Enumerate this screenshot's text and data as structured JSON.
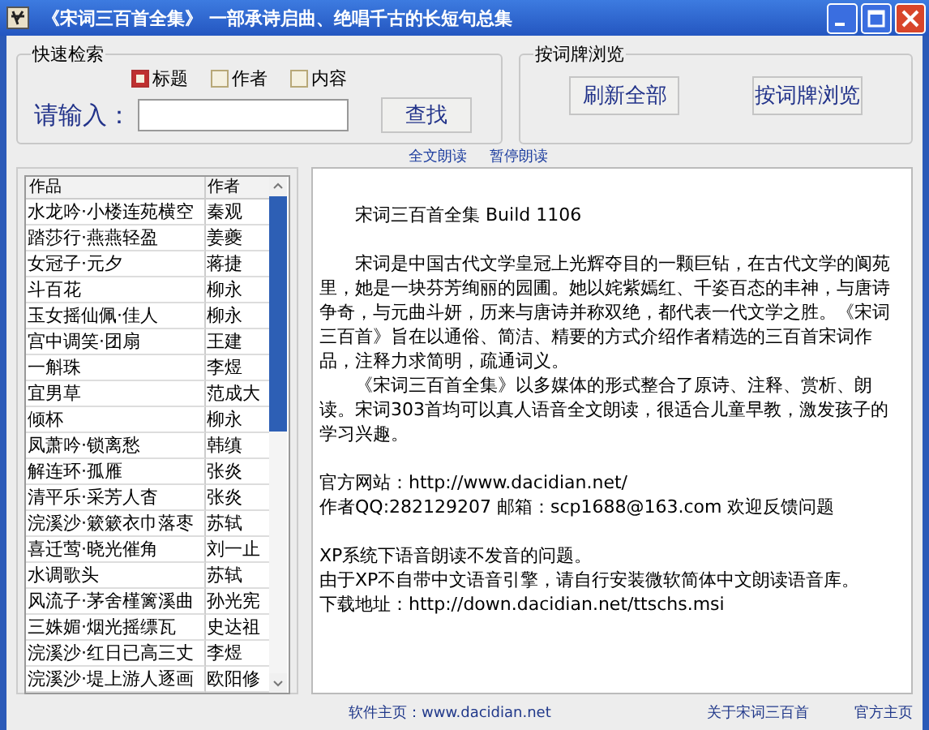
{
  "window": {
    "title": "《宋词三百首全集》  一部承诗启曲、绝唱千古的长短句总集"
  },
  "search": {
    "legend": "快速检索",
    "options": [
      {
        "label": "标题",
        "checked": true
      },
      {
        "label": "作者",
        "checked": false
      },
      {
        "label": "内容",
        "checked": false
      }
    ],
    "input_label": "请输入：",
    "button": "查找"
  },
  "browse": {
    "legend": "按词牌浏览",
    "buttons": [
      "刷新全部",
      "按词牌浏览"
    ]
  },
  "read_links": [
    "全文朗读",
    "暂停朗读"
  ],
  "list": {
    "columns": [
      "作品",
      "作者"
    ],
    "rows": [
      {
        "title": "水龙吟·小楼连苑横空",
        "author": "秦观"
      },
      {
        "title": "踏莎行·燕燕轻盈",
        "author": "姜夔"
      },
      {
        "title": "女冠子·元夕",
        "author": "蒋捷"
      },
      {
        "title": "斗百花",
        "author": "柳永"
      },
      {
        "title": "玉女摇仙佩·佳人",
        "author": "柳永"
      },
      {
        "title": "宫中调笑·团扇",
        "author": "王建"
      },
      {
        "title": "一斛珠",
        "author": "李煜"
      },
      {
        "title": "宜男草",
        "author": "范成大"
      },
      {
        "title": "倾杯",
        "author": "柳永"
      },
      {
        "title": "凤萧吟·锁离愁",
        "author": "韩缜"
      },
      {
        "title": "解连环·孤雁",
        "author": "张炎"
      },
      {
        "title": "清平乐·采芳人杳",
        "author": "张炎"
      },
      {
        "title": "浣溪沙·簌簌衣巾落枣",
        "author": "苏轼"
      },
      {
        "title": "喜迁莺·晓光催角",
        "author": "刘一止"
      },
      {
        "title": "水调歌头",
        "author": "苏轼"
      },
      {
        "title": "风流子·茅舍槿篱溪曲",
        "author": "孙光宪"
      },
      {
        "title": "三姝媚·烟光摇缥瓦",
        "author": "史达祖"
      },
      {
        "title": "浣溪沙·红日已高三丈",
        "author": "李煜"
      },
      {
        "title": "浣溪沙·堤上游人逐画",
        "author": "欧阳修"
      }
    ]
  },
  "text_sections": [
    {
      "paragraphs": [
        {
          "text": "宋词三百首全集 Build 1106",
          "indented": true
        }
      ]
    },
    {
      "paragraphs": [
        {
          "text": "宋词是中国古代文学皇冠上光辉夺目的一颗巨钻，在古代文学的阆苑里，她是一块芬芳绚丽的园圃。她以姹紫嫣红、千姿百态的丰神，与唐诗争奇，与元曲斗妍，历来与唐诗并称双绝，都代表一代文学之胜。《宋词三百首》旨在以通俗、简洁、精要的方式介绍作者精选的三百首宋词作品，注释力求简明，疏通词义。",
          "indented": true
        },
        {
          "text": "《宋词三百首全集》以多媒体的形式整合了原诗、注释、赏析、朗读。宋词303首均可以真人语音全文朗读，很适合儿童早教，激发孩子的学习兴趣。",
          "indented": true
        }
      ]
    },
    {
      "paragraphs": [
        {
          "text": "官方网站：http://www.dacidian.net/",
          "indented": false
        },
        {
          "text": "作者QQ:282129207 邮箱：scp1688@163.com  欢迎反馈问题",
          "indented": false
        }
      ]
    },
    {
      "paragraphs": [
        {
          "text": "XP系统下语音朗读不发音的问题。",
          "indented": false
        },
        {
          "text": "由于XP不自带中文语音引擎，请自行安装微软简体中文朗读语音库。",
          "indented": false
        },
        {
          "text": "下载地址：http://down.dacidian.net/ttschs.msi",
          "indented": false
        }
      ]
    }
  ],
  "footer": {
    "home": "软件主页：www.dacidian.net",
    "about": "关于宋词三百首",
    "official": "官方主页"
  }
}
